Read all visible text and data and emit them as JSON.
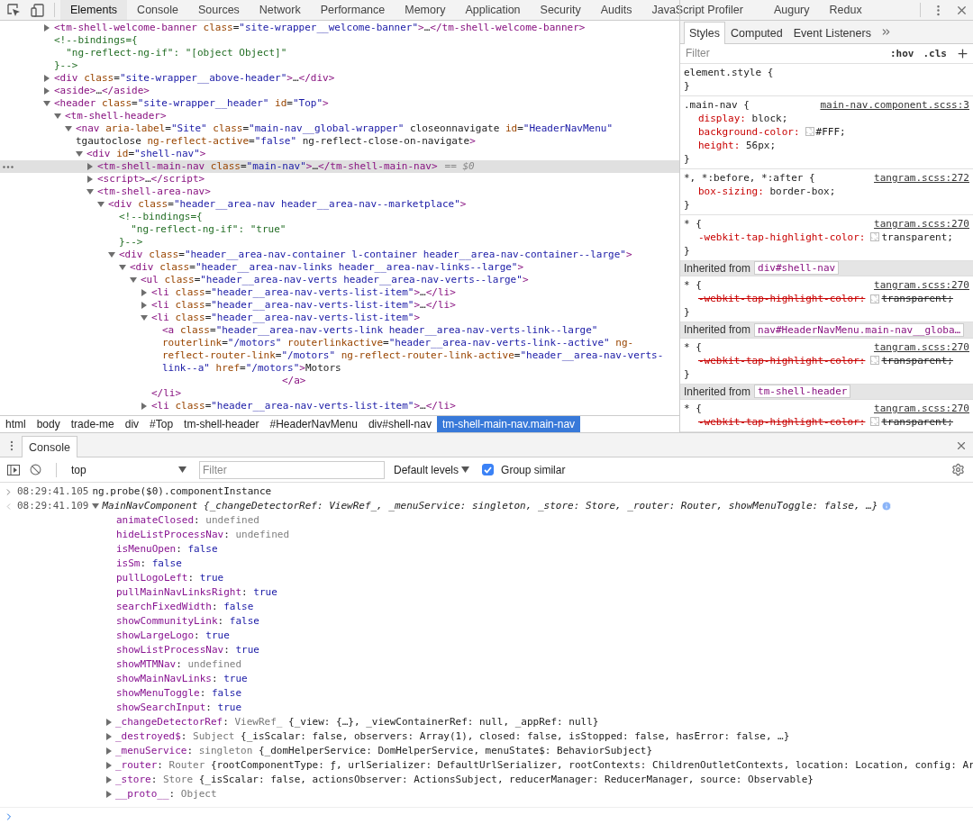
{
  "toolbar": {
    "tabs": [
      {
        "label": "Elements",
        "selected": true
      },
      {
        "label": "Console",
        "selected": false
      },
      {
        "label": "Sources",
        "selected": false
      },
      {
        "label": "Network",
        "selected": false
      },
      {
        "label": "Performance",
        "selected": false
      },
      {
        "label": "Memory",
        "selected": false
      },
      {
        "label": "Application",
        "selected": false
      },
      {
        "label": "Security",
        "selected": false
      },
      {
        "label": "Audits",
        "selected": false
      },
      {
        "label": "JavaScript Profiler",
        "selected": false
      },
      {
        "label": "Augury",
        "selected": false
      },
      {
        "label": "Redux",
        "selected": false
      }
    ]
  },
  "elements": {
    "tree": [
      {
        "kind": "element",
        "text": "<tm-shell-welcome-banner class=\"site-wrapper__welcome-banner\">…</tm-shell-welcome-banner>",
        "expanded": false,
        "selected": false
      },
      {
        "kind": "comment",
        "text": "<!--bindings={\n  \"ng-reflect-ng-if\": \"[object Object]\"\n}-->",
        "selected": false
      },
      {
        "kind": "element",
        "text": "<div class=\"site-wrapper__above-header\">…</div>",
        "expanded": false,
        "selected": false
      },
      {
        "kind": "element",
        "text": "<aside>…</aside>",
        "expanded": false,
        "selected": false
      },
      {
        "kind": "element",
        "text": "<header class=\"site-wrapper__header\" id=\"Top\">",
        "expanded": true,
        "selected": false,
        "children": [
          {
            "kind": "element",
            "text": "<tm-shell-header>",
            "expanded": true,
            "selected": false,
            "children": [
              {
                "kind": "element",
                "text": "<nav aria-label=\"Site\" class=\"main-nav__global-wrapper\" closeonnavigate id=\"HeaderNavMenu\" tgautoclose ng-reflect-active=\"false\" ng-reflect-close-on-navigate>",
                "expanded": true,
                "selected": false,
                "children": [
                  {
                    "kind": "element",
                    "text": "<div id=\"shell-nav\">",
                    "expanded": true,
                    "selected": false,
                    "children": [
                      {
                        "kind": "element",
                        "text": "<tm-shell-main-nav class=\"main-nav\">…</tm-shell-main-nav>",
                        "suffix": "== $0",
                        "expanded": false,
                        "selected": true
                      },
                      {
                        "kind": "element",
                        "text": "<script>…</script>",
                        "expanded": false,
                        "selected": false
                      },
                      {
                        "kind": "element",
                        "text": "<tm-shell-area-nav>",
                        "expanded": true,
                        "selected": false,
                        "children": [
                          {
                            "kind": "element",
                            "text": "<div class=\"header__area-nav header__area-nav--marketplace\">",
                            "expanded": true,
                            "selected": false,
                            "children": [
                              {
                                "kind": "comment",
                                "text": "<!--bindings={\n  \"ng-reflect-ng-if\": \"true\"\n}-->",
                                "selected": false
                              },
                              {
                                "kind": "element",
                                "text": "<div class=\"header__area-nav-container l-container header__area-nav-container--large\">",
                                "expanded": true,
                                "selected": false,
                                "children": [
                                  {
                                    "kind": "element",
                                    "text": "<div class=\"header__area-nav-links header__area-nav-links--large\">",
                                    "expanded": true,
                                    "selected": false,
                                    "children": [
                                      {
                                        "kind": "element",
                                        "text": "<ul class=\"header__area-nav-verts header__area-nav-verts--large\">",
                                        "expanded": true,
                                        "selected": false,
                                        "children": [
                                          {
                                            "kind": "element",
                                            "text": "<li class=\"header__area-nav-verts-list-item\">…</li>",
                                            "expanded": false,
                                            "selected": false
                                          },
                                          {
                                            "kind": "element",
                                            "text": "<li class=\"header__area-nav-verts-list-item\">…</li>",
                                            "expanded": false,
                                            "selected": false
                                          },
                                          {
                                            "kind": "element",
                                            "text": "<li class=\"header__area-nav-verts-list-item\">",
                                            "expanded": true,
                                            "selected": false,
                                            "close": "</li>",
                                            "children": [
                                              {
                                                "kind": "leaf",
                                                "text": "<a class=\"header__area-nav-verts-link header__area-nav-verts-link--large\" routerlink=\"/motors\" routerlinkactive=\"header__area-nav-verts-link--active\" ng-reflect-router-link=\"/motors\" ng-reflect-router-link-active=\"header__area-nav-verts-link--a\" href=\"/motors\">Motors",
                                                "close": "</a>",
                                                "selected": false
                                              }
                                            ]
                                          },
                                          {
                                            "kind": "element",
                                            "text": "<li class=\"header__area-nav-verts-list-item\">…</li>",
                                            "expanded": false,
                                            "selected": false
                                          }
                                        ]
                                      }
                                    ]
                                  }
                                ]
                              }
                            ]
                          }
                        ]
                      }
                    ]
                  }
                ]
              }
            ]
          }
        ]
      }
    ],
    "breadcrumbs": [
      {
        "label": "html",
        "selected": false
      },
      {
        "label": "body",
        "selected": false
      },
      {
        "label": "trade-me",
        "selected": false
      },
      {
        "label": "div",
        "selected": false
      },
      {
        "label": "#Top",
        "selected": false
      },
      {
        "label": "tm-shell-header",
        "selected": false
      },
      {
        "label": "#HeaderNavMenu",
        "selected": false
      },
      {
        "label": "div#shell-nav",
        "selected": false
      },
      {
        "label": "tm-shell-main-nav.main-nav",
        "selected": true
      }
    ]
  },
  "styles": {
    "tabs": [
      {
        "label": "Styles",
        "selected": true
      },
      {
        "label": "Computed",
        "selected": false
      },
      {
        "label": "Event Listeners",
        "selected": false
      }
    ],
    "filter": {
      "placeholder": "Filter"
    },
    "hov": ":hov",
    "cls": ".cls",
    "sections": [
      {
        "kind": "rule",
        "selector": "element.style {",
        "close": "}"
      },
      {
        "kind": "rule",
        "selector": ".main-nav {",
        "source": "main-nav.component.scss:3",
        "properties": [
          {
            "name": "display:",
            "value": "block;",
            "struck": false
          },
          {
            "name": "background-color:",
            "value": "#FFF;",
            "swatch": true,
            "struck": false
          },
          {
            "name": "height:",
            "value": "56px;",
            "struck": false
          }
        ],
        "close": "}"
      },
      {
        "kind": "rule",
        "selector": "*, *:before, *:after {",
        "source": "tangram.scss:272",
        "properties": [
          {
            "name": "box-sizing:",
            "value": "border-box;",
            "struck": false
          }
        ],
        "close": "}"
      },
      {
        "kind": "rule",
        "selector": "* {",
        "source": "tangram.scss:270",
        "properties": [
          {
            "name": "-webkit-tap-highlight-color:",
            "value": "transparent;",
            "swatch": true,
            "struck": false
          }
        ],
        "close": "}"
      },
      {
        "kind": "inherited",
        "label": "Inherited from",
        "source": "div#shell-nav"
      },
      {
        "kind": "rule",
        "selector": "* {",
        "source": "tangram.scss:270",
        "properties": [
          {
            "name": "-webkit-tap-highlight-color:",
            "value": "transparent;",
            "swatch": true,
            "struck": true
          }
        ],
        "close": "}"
      },
      {
        "kind": "inherited",
        "label": "Inherited from",
        "source": "nav#HeaderNavMenu.main-nav__globa…"
      },
      {
        "kind": "rule",
        "selector": "* {",
        "source": "tangram.scss:270",
        "properties": [
          {
            "name": "-webkit-tap-highlight-color:",
            "value": "transparent;",
            "swatch": true,
            "struck": true
          }
        ],
        "close": "}"
      },
      {
        "kind": "inherited",
        "label": "Inherited from",
        "source": "tm-shell-header"
      },
      {
        "kind": "rule",
        "selector": "* {",
        "source": "tangram.scss:270",
        "properties": [
          {
            "name": "-webkit-tap-highlight-color:",
            "value": "transparent;",
            "swatch": true,
            "struck": true
          }
        ]
      }
    ]
  },
  "drawer": {
    "tabs": [
      {
        "label": "Console",
        "selected": true
      }
    ],
    "context": "top",
    "filter": {
      "placeholder": "Filter"
    },
    "levels": "Default levels",
    "group_similar": {
      "label": "Group similar",
      "checked": true
    },
    "messages": [
      {
        "kind": "input",
        "time": "08:29:41.105",
        "text": "ng.probe($0).componentInstance"
      },
      {
        "kind": "output",
        "time": "08:29:41.109",
        "summary": "MainNavComponent {_changeDetectorRef: ViewRef_, _menuService: singleton, _store: Store, _router: Router, showMenuToggle: false, …}",
        "expanded": true,
        "properties": [
          {
            "kind": "undefined",
            "text": "animateClosed: undefined"
          },
          {
            "kind": "undefined",
            "text": "hideListProcessNav: undefined"
          },
          {
            "kind": "boolean",
            "text": "isMenuOpen: false"
          },
          {
            "kind": "boolean",
            "text": "isSm: false"
          },
          {
            "kind": "boolean",
            "text": "pullLogoLeft: true"
          },
          {
            "kind": "boolean",
            "text": "pullMainNavLinksRight: true"
          },
          {
            "kind": "boolean",
            "text": "searchFixedWidth: false"
          },
          {
            "kind": "boolean",
            "text": "showCommunityLink: false"
          },
          {
            "kind": "boolean",
            "text": "showLargeLogo: true"
          },
          {
            "kind": "boolean",
            "text": "showListProcessNav: true"
          },
          {
            "kind": "undefined",
            "text": "showMTMNav: undefined"
          },
          {
            "kind": "boolean",
            "text": "showMainNavLinks: true"
          },
          {
            "kind": "boolean",
            "text": "showMenuToggle: false"
          },
          {
            "kind": "boolean",
            "text": "showSearchInput: true"
          },
          {
            "kind": "object",
            "text": "_changeDetectorRef: ViewRef_ {_view: {…}, _viewContainerRef: null, _appRef: null}",
            "expanded": false
          },
          {
            "kind": "object",
            "text": "_destroyed$: Subject {_isScalar: false, observers: Array(1), closed: false, isStopped: false, hasError: false, …}",
            "expanded": false
          },
          {
            "kind": "object",
            "text": "_menuService: singleton {_domHelperService: DomHelperService, menuState$: BehaviorSubject}",
            "expanded": false
          },
          {
            "kind": "object",
            "text": "_router: Router {rootComponentType: ƒ, urlSerializer: DefaultUrlSerializer, rootContexts: ChildrenOutletContexts, location: Location, config: Ar",
            "expanded": false
          },
          {
            "kind": "object",
            "text": "_store: Store {_isScalar: false, actionsObserver: ActionsSubject, reducerManager: ReducerManager, source: Observable}",
            "expanded": false
          },
          {
            "kind": "object",
            "text": "__proto__: Object",
            "expanded": false
          }
        ]
      }
    ]
  }
}
